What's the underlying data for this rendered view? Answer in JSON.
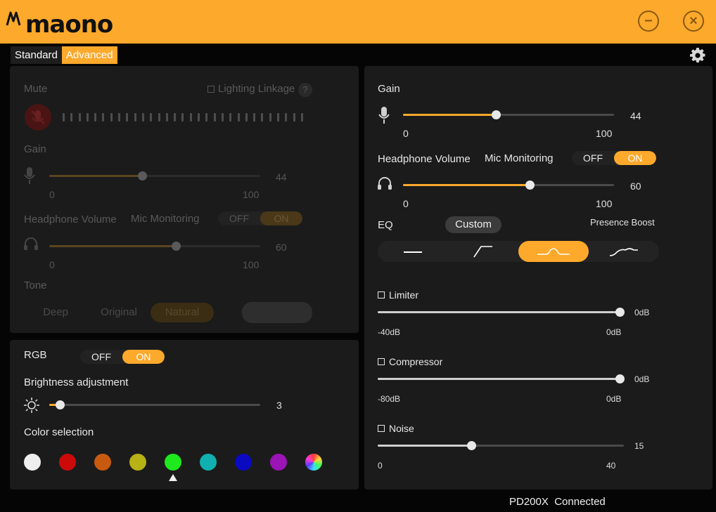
{
  "app": {
    "brand": "maono",
    "status_device": "PD200X",
    "status_state": "Connected"
  },
  "colors": {
    "accent": "#fca92c",
    "panel": "#1b1b1b",
    "background": "#050505"
  },
  "window_controls": {
    "minimize_icon": "minus-circle-icon",
    "close_icon": "x-circle-icon",
    "minimize": "−",
    "close": "×"
  },
  "tabs": [
    {
      "label": "Standard",
      "active": false
    },
    {
      "label": "Advanced",
      "active": true
    }
  ],
  "standard_panel": {
    "mute_label": "Mute",
    "lighting_linkage_label": "Lighting Linkage",
    "help": "?",
    "gain_label": "Gain",
    "gain": {
      "value": "44",
      "min": "0",
      "max": "100",
      "fraction": 0.44
    },
    "headphone_volume_label": "Headphone Volume",
    "mic_monitoring_label": "Mic Monitoring",
    "monitoring": {
      "off": "OFF",
      "on": "ON",
      "state": "on"
    },
    "headphone": {
      "value": "60",
      "min": "0",
      "max": "100",
      "fraction": 0.6
    },
    "tone_label": "Tone",
    "tones": [
      "Deep",
      "Original",
      "Natural"
    ],
    "tone_selected": "Natural"
  },
  "rgb": {
    "label": "RGB",
    "toggle": {
      "off": "OFF",
      "on": "ON",
      "state": "on"
    },
    "brightness_label": "Brightness adjustment",
    "brightness": {
      "value": "3",
      "fraction": 0.05
    },
    "color_selection_label": "Color selection",
    "colors": [
      "#eeeeee",
      "#cc0a0a",
      "#c85a10",
      "#b7b215",
      "#1ee81e",
      "#10b0b0",
      "#0a0ac0",
      "#9a14b6",
      "rainbow"
    ],
    "selected_index": 4
  },
  "advanced": {
    "gain_label": "Gain",
    "gain": {
      "value": "44",
      "min": "0",
      "max": "100",
      "fraction": 0.44
    },
    "headphone_volume_label": "Headphone Volume",
    "mic_monitoring_label": "Mic Monitoring",
    "monitoring": {
      "off": "OFF",
      "on": "ON",
      "state": "on"
    },
    "headphone": {
      "value": "60",
      "min": "0",
      "max": "100",
      "fraction": 0.6
    },
    "eq_label": "EQ",
    "eq_preset": "Custom",
    "presence_boost_label": "Presence Boost",
    "eq_options": [
      "flat-icon",
      "high-pass-icon",
      "mid-boost-icon",
      "presence-boost-icon"
    ],
    "eq_selected": 2,
    "limiter": {
      "label": "Limiter",
      "value": "0dB",
      "min": "-40dB",
      "max": "0dB",
      "fraction": 1.0
    },
    "compressor": {
      "label": "Compressor",
      "value": "0dB",
      "min": "-80dB",
      "max": "0dB",
      "fraction": 1.0
    },
    "noise": {
      "label": "Noise",
      "value": "15",
      "min": "0",
      "max": "40",
      "fraction": 0.375
    }
  }
}
